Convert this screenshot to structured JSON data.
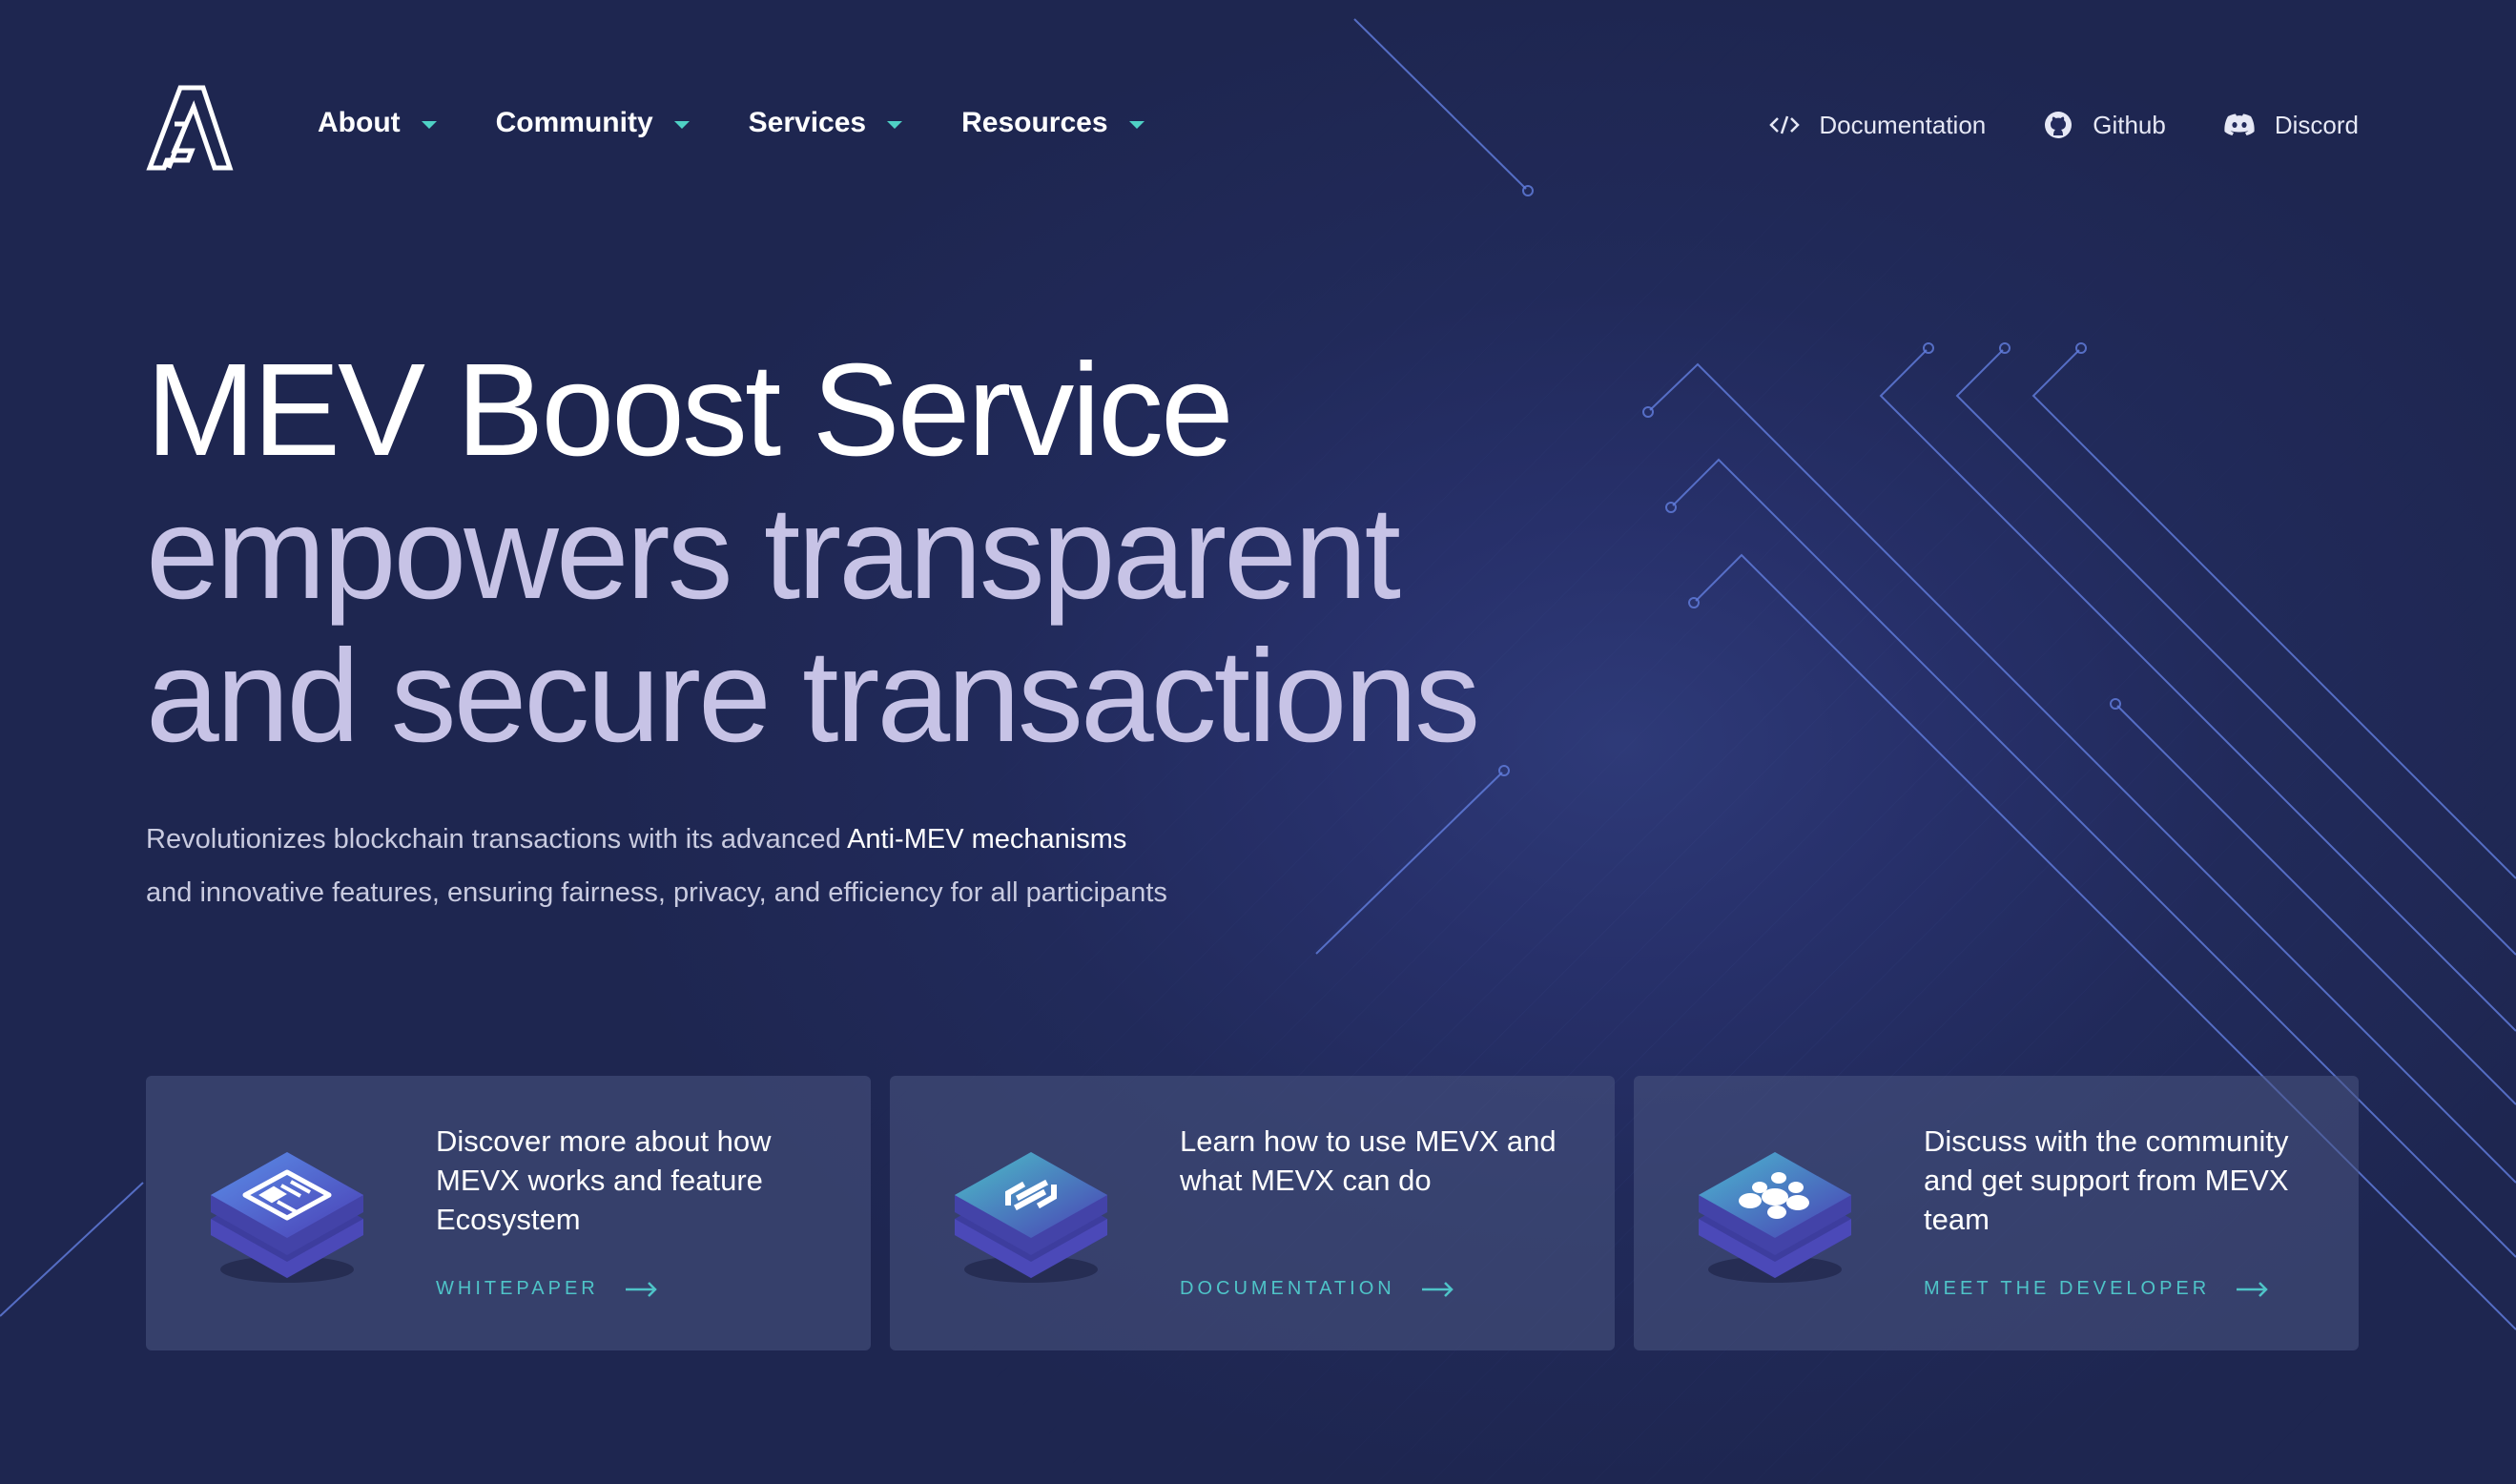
{
  "colors": {
    "accent": "#4fc4c8",
    "heading": "#ffffff",
    "subheading": "#c7c3e6",
    "background": "#232b5c"
  },
  "nav": {
    "items": [
      {
        "label": "About",
        "icon": "chevron-down-icon"
      },
      {
        "label": "Community",
        "icon": "chevron-down-icon"
      },
      {
        "label": "Services",
        "icon": "chevron-down-icon"
      },
      {
        "label": "Resources",
        "icon": "chevron-down-icon"
      }
    ]
  },
  "top_links": [
    {
      "label": "Documentation",
      "icon": "code-icon"
    },
    {
      "label": "Github",
      "icon": "github-icon"
    },
    {
      "label": "Discord",
      "icon": "discord-icon"
    }
  ],
  "hero": {
    "line1": "MEV Boost Service",
    "line2": "empowers transparent",
    "line3": "and secure transactions",
    "desc_part1": "Revolutionizes blockchain transactions with its advanced ",
    "desc_highlight": "Anti-MEV mechanisms",
    "desc_part2": "and innovative features, ensuring fairness, privacy, and efficiency for all participants"
  },
  "cards": [
    {
      "text": "Discover more about how MEVX works and feature Ecosystem",
      "link": "WHITEPAPER",
      "icon": "document-icon"
    },
    {
      "text": "Learn how to use MEVX and what MEVX can do",
      "link": "DOCUMENTATION",
      "icon": "exchange-icon"
    },
    {
      "text": "Discuss with the community and get support from MEVX team",
      "link": "MEET THE DEVELOPER",
      "icon": "team-icon"
    }
  ]
}
